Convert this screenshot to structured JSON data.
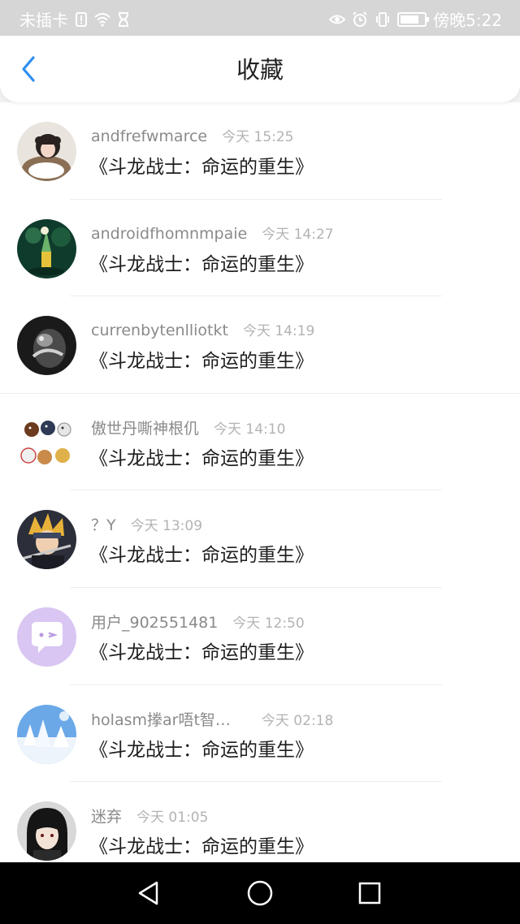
{
  "status_bar": {
    "carrier": "未插卡",
    "time": "傍晚5:22",
    "battery_level": 0.8,
    "icons": [
      "sim-alert-icon",
      "wifi-icon",
      "hourglass-icon",
      "eye-icon",
      "alarm-icon",
      "vibrate-icon",
      "battery-icon"
    ]
  },
  "header": {
    "title": "收藏",
    "back_icon": "chevron-left-icon",
    "accent_color": "#2f8ef0"
  },
  "items": [
    {
      "username": "andfrefwmarce",
      "time": "今天 15:25",
      "title": "《斗龙战士：命运的重生》"
    },
    {
      "username": "androidfhomnmpaie",
      "time": "今天 14:27",
      "title": "《斗龙战士：命运的重生》"
    },
    {
      "username": "currenbytenlliotkt",
      "time": "今天 14:19",
      "title": "《斗龙战士：命运的重生》"
    },
    {
      "username": "傲世丹嘶神根仉",
      "time": "今天 14:10",
      "title": "《斗龙战士：命运的重生》"
    },
    {
      "username": "？Y",
      "time": "今天 13:09",
      "title": "《斗龙战士：命运的重生》"
    },
    {
      "username": "用户_902551481",
      "time": "今天 12:50",
      "title": "《斗龙战士：命运的重生》"
    },
    {
      "username": "holasm搼ar唔t智…",
      "time": "今天 02:18",
      "title": "《斗龙战士：命运的重生》"
    },
    {
      "username": "迷弃",
      "time": "今天 01:05",
      "title": "《斗龙战士：命运的重生》"
    }
  ],
  "nav_bar": {
    "icons": [
      "back-triangle-icon",
      "home-circle-icon",
      "recents-square-icon"
    ]
  }
}
